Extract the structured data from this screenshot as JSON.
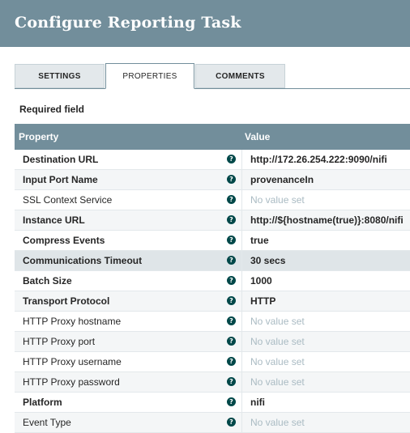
{
  "header": {
    "title": "Configure Reporting Task"
  },
  "tabs": [
    {
      "label": "SETTINGS",
      "active": false
    },
    {
      "label": "PROPERTIES",
      "active": true
    },
    {
      "label": "COMMENTS",
      "active": false
    }
  ],
  "required_label": "Required field",
  "table": {
    "col_property": "Property",
    "col_value": "Value",
    "rows": [
      {
        "name": "Destination URL",
        "value": "http://172.26.254.222:9090/nifi",
        "required": true,
        "set": true
      },
      {
        "name": "Input Port Name",
        "value": "provenanceIn",
        "required": true,
        "set": true
      },
      {
        "name": "SSL Context Service",
        "value": "No value set",
        "required": false,
        "set": false
      },
      {
        "name": "Instance URL",
        "value": "http://${hostname(true)}:8080/nifi",
        "required": true,
        "set": true
      },
      {
        "name": "Compress Events",
        "value": "true",
        "required": true,
        "set": true
      },
      {
        "name": "Communications Timeout",
        "value": "30 secs",
        "required": true,
        "set": true
      },
      {
        "name": "Batch Size",
        "value": "1000",
        "required": true,
        "set": true
      },
      {
        "name": "Transport Protocol",
        "value": "HTTP",
        "required": true,
        "set": true
      },
      {
        "name": "HTTP Proxy hostname",
        "value": "No value set",
        "required": false,
        "set": false
      },
      {
        "name": "HTTP Proxy port",
        "value": "No value set",
        "required": false,
        "set": false
      },
      {
        "name": "HTTP Proxy username",
        "value": "No value set",
        "required": false,
        "set": false
      },
      {
        "name": "HTTP Proxy password",
        "value": "No value set",
        "required": false,
        "set": false
      },
      {
        "name": "Platform",
        "value": "nifi",
        "required": true,
        "set": true
      },
      {
        "name": "Event Type",
        "value": "No value set",
        "required": false,
        "set": false
      }
    ]
  },
  "help_icon": "question-circle-icon"
}
